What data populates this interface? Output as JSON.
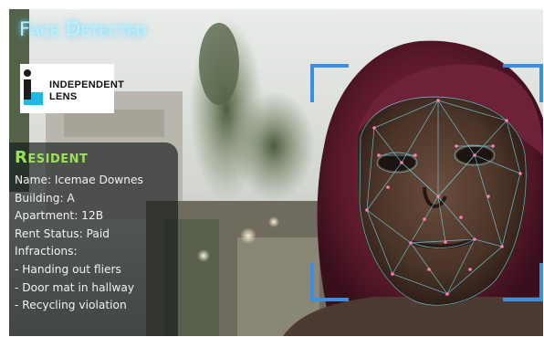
{
  "overlay": {
    "headline": "Face Detected"
  },
  "logo": {
    "line1": "INDEPENDENT",
    "line2": "LENS",
    "icon": "independent-lens-logo",
    "colors": {
      "dark": "#1b1b1b",
      "accent": "#22b7e3"
    }
  },
  "profile": {
    "title": "Resident",
    "name": "Name: Icemae Downes",
    "building": "Building: A",
    "apartment": "Apartment: 12B",
    "rent_status": "Rent Status: Paid",
    "infractions_label": "Infractions:",
    "infractions": [
      "- Handing out fliers",
      "- Door mat in hallway",
      "- Recycling violation"
    ]
  },
  "colors": {
    "headline_glow": "#b8f2ff",
    "title_green": "#9ae05a",
    "bracket_blue": "#3b8fe0",
    "mesh_cyan": "#7fe6ff",
    "mesh_points": "#ff7fb0"
  }
}
